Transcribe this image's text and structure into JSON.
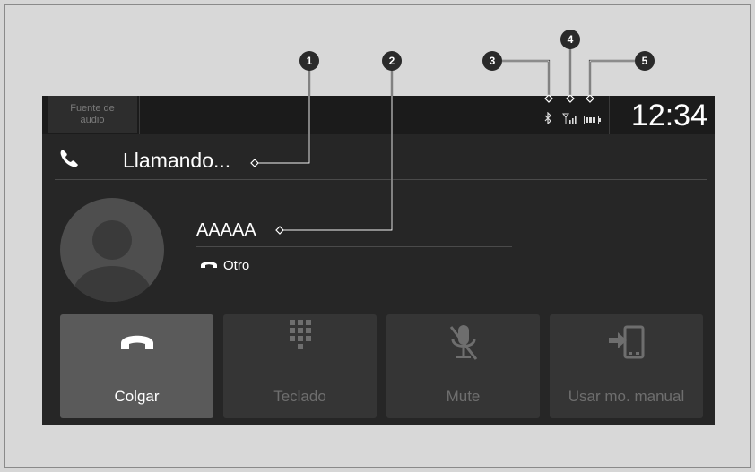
{
  "topbar": {
    "source_label": "Fuente de\naudio",
    "time": "12:34"
  },
  "call": {
    "status": "Llamando...",
    "contact_name": "AAAAA",
    "phone_type": "Otro"
  },
  "buttons": [
    {
      "label": "Colgar",
      "icon": "hang-up-icon",
      "enabled": true
    },
    {
      "label": "Teclado",
      "icon": "keypad-icon",
      "enabled": false
    },
    {
      "label": "Mute",
      "icon": "mute-mic-icon",
      "enabled": false
    },
    {
      "label": "Usar mo. manual",
      "icon": "transfer-to-phone-icon",
      "enabled": false
    }
  ],
  "callouts": [
    "1",
    "2",
    "3",
    "4",
    "5"
  ],
  "colors": {
    "screen_bg": "#262626",
    "button_active": "#5a5a5a",
    "button_inactive": "#353535",
    "text": "#ffffff"
  }
}
